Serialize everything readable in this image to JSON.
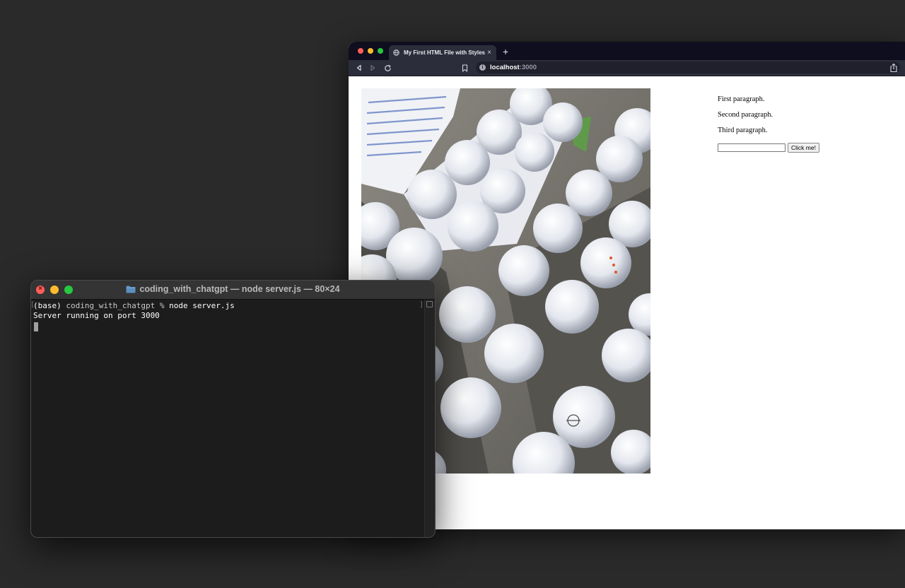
{
  "browser": {
    "tab": {
      "title": "My First HTML File with Stylesh",
      "close": "×"
    },
    "new_tab": "+",
    "url": {
      "host": "localhost",
      "port": ":3000"
    },
    "info_icon": "i"
  },
  "page": {
    "paragraphs": [
      "First paragraph.",
      "Second paragraph.",
      "Third paragraph."
    ],
    "input": {
      "value": "",
      "placeholder": ""
    },
    "button_label": "Click me!"
  },
  "terminal": {
    "title": "coding_with_chatgpt — node server.js — 80×24",
    "lines": {
      "prompt_env": "(base)",
      "prompt_dir": " coding_with_chatgpt % ",
      "prompt_cmd": "node server.js",
      "output": "Server running on port 3000"
    }
  },
  "colors": {
    "desktop": "#2a2a2a",
    "browser_chrome": "#2c2d3b",
    "terminal_bg": "#1c1c1c",
    "close": "#ff5f57",
    "minimize": "#febc2e",
    "zoom": "#28c840"
  }
}
